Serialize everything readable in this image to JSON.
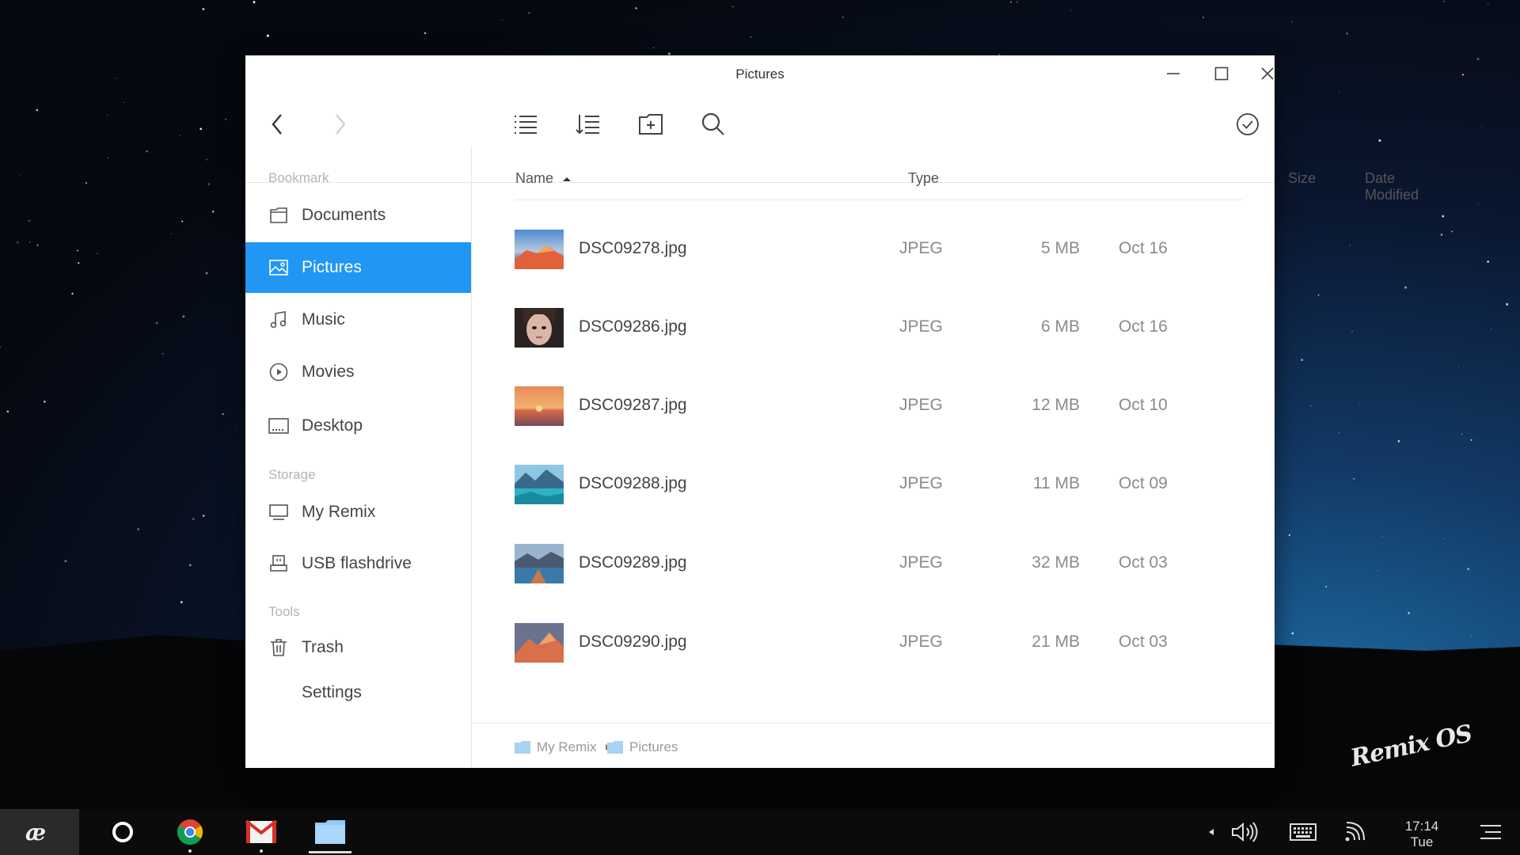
{
  "window": {
    "title": "Pictures"
  },
  "sidebar": {
    "sections": [
      "Bookmark",
      "Storage",
      "Tools"
    ],
    "items": [
      {
        "label": "Documents",
        "icon": "folder-icon"
      },
      {
        "label": "Pictures",
        "icon": "image-icon",
        "active": true
      },
      {
        "label": "Music",
        "icon": "music-note-icon"
      },
      {
        "label": "Movies",
        "icon": "play-circle-icon"
      },
      {
        "label": "Desktop",
        "icon": "desktop-icon"
      },
      {
        "label": "My Remix",
        "icon": "monitor-icon"
      },
      {
        "label": "USB flashdrive",
        "icon": "usb-drive-icon"
      },
      {
        "label": "Trash",
        "icon": "trash-icon"
      },
      {
        "label": "Settings",
        "icon": ""
      }
    ]
  },
  "table": {
    "columns": [
      "Name",
      "Type",
      "Size",
      "Date Modified"
    ],
    "sort": {
      "column": "Name",
      "direction": "ascending"
    },
    "rows": [
      {
        "name": "DSC09278.jpg",
        "type": "JPEG",
        "size": "5 MB",
        "date": "Oct 16"
      },
      {
        "name": "DSC09286.jpg",
        "type": "JPEG",
        "size": "6 MB",
        "date": "Oct 16"
      },
      {
        "name": "DSC09287.jpg",
        "type": "JPEG",
        "size": "12 MB",
        "date": "Oct 10"
      },
      {
        "name": "DSC09288.jpg",
        "type": "JPEG",
        "size": "11 MB",
        "date": "Oct 09"
      },
      {
        "name": "DSC09289.jpg",
        "type": "JPEG",
        "size": "32 MB",
        "date": "Oct 03"
      },
      {
        "name": "DSC09290.jpg",
        "type": "JPEG",
        "size": "21 MB",
        "date": "Oct 03"
      }
    ]
  },
  "breadcrumb": [
    "My Remix",
    "Pictures"
  ],
  "taskbar": {
    "apps": [
      "remix-start-icon",
      "circle-home-icon",
      "chrome-icon",
      "gmail-icon",
      "files-icon"
    ],
    "clock_time": "17:14",
    "clock_day": "Tue"
  },
  "brand": "Remix OS",
  "colors": {
    "accent": "#2196f3",
    "taskbar": "#0b0b0b"
  }
}
